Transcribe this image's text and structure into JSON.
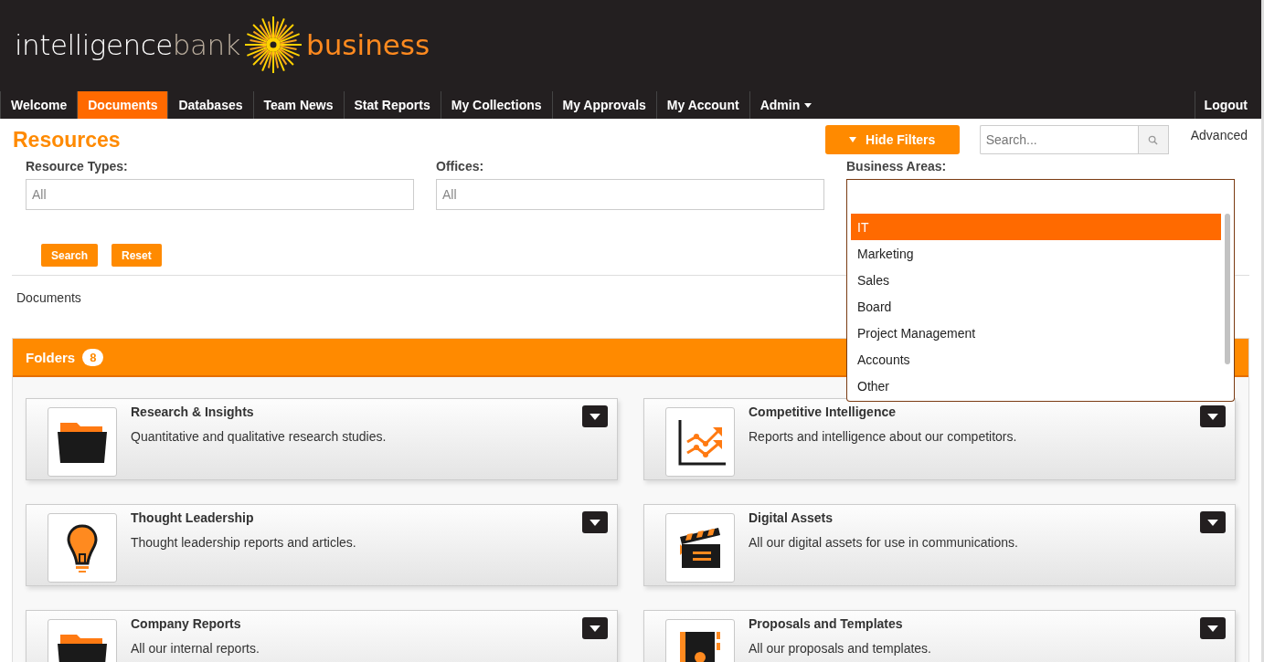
{
  "header": {
    "logo": {
      "word_1": "intelligence",
      "word_2": "bank",
      "word_3": "business"
    }
  },
  "nav": {
    "items": [
      {
        "label": "Welcome",
        "selected": false,
        "has_menu": false
      },
      {
        "label": "Documents",
        "selected": true,
        "has_menu": false
      },
      {
        "label": "Databases",
        "selected": false,
        "has_menu": false
      },
      {
        "label": "Team News",
        "selected": false,
        "has_menu": false
      },
      {
        "label": "Stat Reports",
        "selected": false,
        "has_menu": false
      },
      {
        "label": "My Collections",
        "selected": false,
        "has_menu": false
      },
      {
        "label": "My Approvals",
        "selected": false,
        "has_menu": false
      },
      {
        "label": "My Account",
        "selected": false,
        "has_menu": false
      },
      {
        "label": "Admin",
        "selected": false,
        "has_menu": true
      }
    ],
    "logout": "Logout"
  },
  "page_title": "Resources",
  "toolbar": {
    "hide_filters": "Hide Filters",
    "search": {
      "placeholder": "Search..."
    },
    "advanced": "Advanced"
  },
  "filters": [
    {
      "label": "Resource Types:",
      "placeholder": "All",
      "expanded": false
    },
    {
      "label": "Offices:",
      "placeholder": "All",
      "expanded": false
    },
    {
      "label": "Business Areas:",
      "expanded": true,
      "options": [
        {
          "label": "IT",
          "selected": true
        },
        {
          "label": "Marketing",
          "selected": false
        },
        {
          "label": "Sales",
          "selected": false
        },
        {
          "label": "Board",
          "selected": false
        },
        {
          "label": "Project Management",
          "selected": false
        },
        {
          "label": "Accounts",
          "selected": false
        },
        {
          "label": "Other",
          "selected": false
        }
      ]
    }
  ],
  "filter_buttons": [
    "Search",
    "Reset"
  ],
  "breadcrumb": "Documents",
  "folders": {
    "title": "Folders",
    "count": "8",
    "items": [
      {
        "title": "Research & Insights",
        "description": "Quantitative and qualitative research studies.",
        "kind": "folder"
      },
      {
        "title": "Competitive Intelligence",
        "description": "Reports and intelligence about our competitors.",
        "kind": "chart"
      },
      {
        "title": "Thought Leadership",
        "description": "Thought leadership reports and articles.",
        "kind": "bulb"
      },
      {
        "title": "Digital Assets",
        "description": "All our digital assets for use in communications.",
        "kind": "clapper"
      },
      {
        "title": "Company Reports",
        "description": "All our internal reports.",
        "kind": "folder"
      },
      {
        "title": "Proposals and Templates",
        "description": "All our proposals and templates.",
        "kind": "contact"
      }
    ]
  }
}
